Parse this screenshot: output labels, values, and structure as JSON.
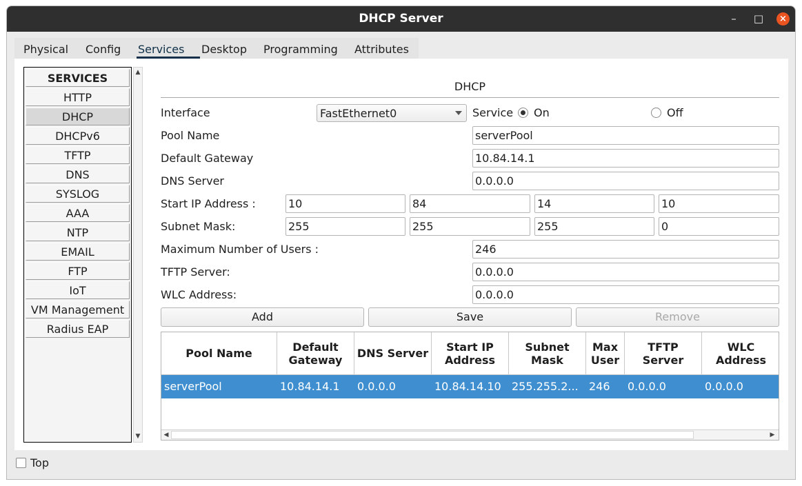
{
  "window": {
    "title": "DHCP Server",
    "minimize": "–",
    "maximize": "□",
    "close": "×"
  },
  "tabs": [
    {
      "label": "Physical"
    },
    {
      "label": "Config"
    },
    {
      "label": "Services"
    },
    {
      "label": "Desktop"
    },
    {
      "label": "Programming"
    },
    {
      "label": "Attributes"
    }
  ],
  "active_tab": "Services",
  "sidebar": {
    "header": "SERVICES",
    "items": [
      {
        "label": "HTTP"
      },
      {
        "label": "DHCP"
      },
      {
        "label": "DHCPv6"
      },
      {
        "label": "TFTP"
      },
      {
        "label": "DNS"
      },
      {
        "label": "SYSLOG"
      },
      {
        "label": "AAA"
      },
      {
        "label": "NTP"
      },
      {
        "label": "EMAIL"
      },
      {
        "label": "FTP"
      },
      {
        "label": "IoT"
      },
      {
        "label": "VM Management"
      },
      {
        "label": "Radius EAP"
      }
    ],
    "selected": "DHCP"
  },
  "dhcp": {
    "section_title": "DHCP",
    "interface_label": "Interface",
    "interface_value": "FastEthernet0",
    "service_label": "Service",
    "service_on": "On",
    "service_off": "Off",
    "pool_name_label": "Pool Name",
    "pool_name": "serverPool",
    "gateway_label": "Default Gateway",
    "gateway": "10.84.14.1",
    "dns_label": "DNS Server",
    "dns": "0.0.0.0",
    "start_ip_label": "Start IP Address :",
    "start_ip": [
      "10",
      "84",
      "14",
      "10"
    ],
    "subnet_label": "Subnet Mask:",
    "subnet": [
      "255",
      "255",
      "255",
      "0"
    ],
    "max_users_label": "Maximum Number of Users :",
    "max_users": "246",
    "tftp_label": "TFTP Server:",
    "tftp": "0.0.0.0",
    "wlc_label": "WLC Address:",
    "wlc": "0.0.0.0",
    "buttons": {
      "add": "Add",
      "save": "Save",
      "remove": "Remove"
    }
  },
  "table": {
    "headers": [
      "Pool Name",
      "Default Gateway",
      "DNS Server",
      "Start IP Address",
      "Subnet Mask",
      "Max User",
      "TFTP Server",
      "WLC Address"
    ],
    "rows": [
      [
        "serverPool",
        "10.84.14.1",
        "0.0.0.0",
        "10.84.14.10",
        "255.255.2...",
        "246",
        "0.0.0.0",
        "0.0.0.0"
      ]
    ]
  },
  "footer": {
    "top_label": "Top"
  },
  "colors": {
    "titlebar": "#2f2f2f",
    "close": "#e95420",
    "selected_row": "#3f8fd0"
  }
}
